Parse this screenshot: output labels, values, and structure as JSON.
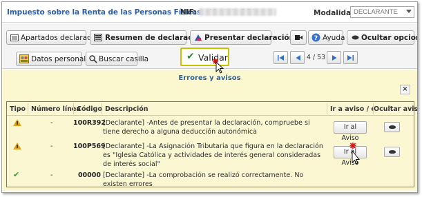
{
  "header": {
    "title": "Impuesto sobre la Renta de las Personas Físicas. -Modelo 100",
    "nif_label": "NIF:",
    "modalidad_label": "Modalidad",
    "modalidad_value": "DECLARANTE"
  },
  "toolbar": {
    "apartados": "Apartados declaración",
    "resumen": "Resumen de declaraciones",
    "presentar": "Presentar declaración",
    "ayuda": "Ayuda",
    "ocultar_opciones": "Ocultar opciones",
    "datos_personales": "Datos personales",
    "buscar_casilla": "Buscar casilla",
    "validar": "Validar",
    "pager": "4 / 53"
  },
  "messages": {
    "title": "Errores y avisos",
    "close": "×",
    "columns": {
      "tipo": "Tipo",
      "numero_linea": "Número línea",
      "codigo": "Código",
      "descripcion": "Descripción",
      "ir_aviso": "Ir a aviso / err",
      "ocultar_aviso": "Ocultar aviso"
    },
    "rows": [
      {
        "tipo": "warning",
        "numero_linea": "-",
        "codigo": "100R392",
        "descripcion": "[Declarante] -Antes de presentar la declaración, compruebe si tiene derecho a alguna deducción autonómica",
        "ir_label": "Ir al Aviso"
      },
      {
        "tipo": "warning",
        "numero_linea": "-",
        "codigo": "100P569",
        "descripcion": "[Declarante] -La Asignación Tributaria que figura en la declaración es \"Iglesia Católica y actividades de interés general consideradas de interés social\"",
        "ir_label": "Ir al Aviso"
      },
      {
        "tipo": "ok",
        "numero_linea": "-",
        "codigo": "00000",
        "descripcion": "[Declarante] -La comprobación se realizó correctamente. No existen errores"
      }
    ]
  },
  "colors": {
    "title_blue": "#2b5ea8",
    "validar_highlight": "#c9c200",
    "panel_yellow": "#fbf8d0",
    "table_border_red": "#e44a3e"
  }
}
